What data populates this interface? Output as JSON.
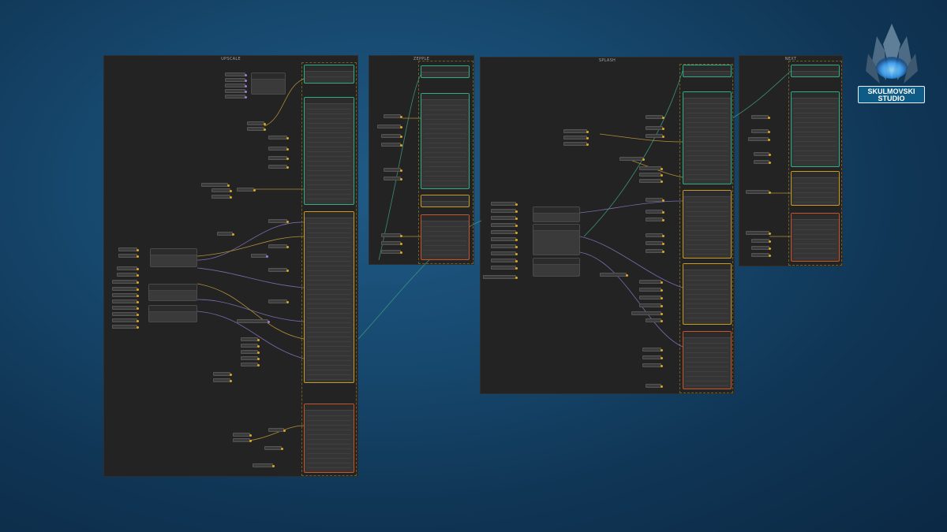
{
  "groups": [
    {
      "id": "group-a",
      "title": "UPSCALE"
    },
    {
      "id": "group-b",
      "title": "ZEPPLE"
    },
    {
      "id": "group-c",
      "title": "SPLASH"
    },
    {
      "id": "group-d",
      "title": "NEXT"
    }
  ],
  "logo": {
    "line1": "SKULMOVSKI",
    "line2": "STUDIO",
    "badge_color": "#0e5c86",
    "crystal_color": "#3fa9ff",
    "icon": "crystal-icon"
  },
  "colors": {
    "node_border_yellow": "#c99a1c",
    "node_border_green": "#2fae86",
    "node_border_red": "#c7542a",
    "wire_purple": "#8a78c4",
    "wire_yellow": "#c9a23a",
    "wire_green": "#3fa37f"
  }
}
